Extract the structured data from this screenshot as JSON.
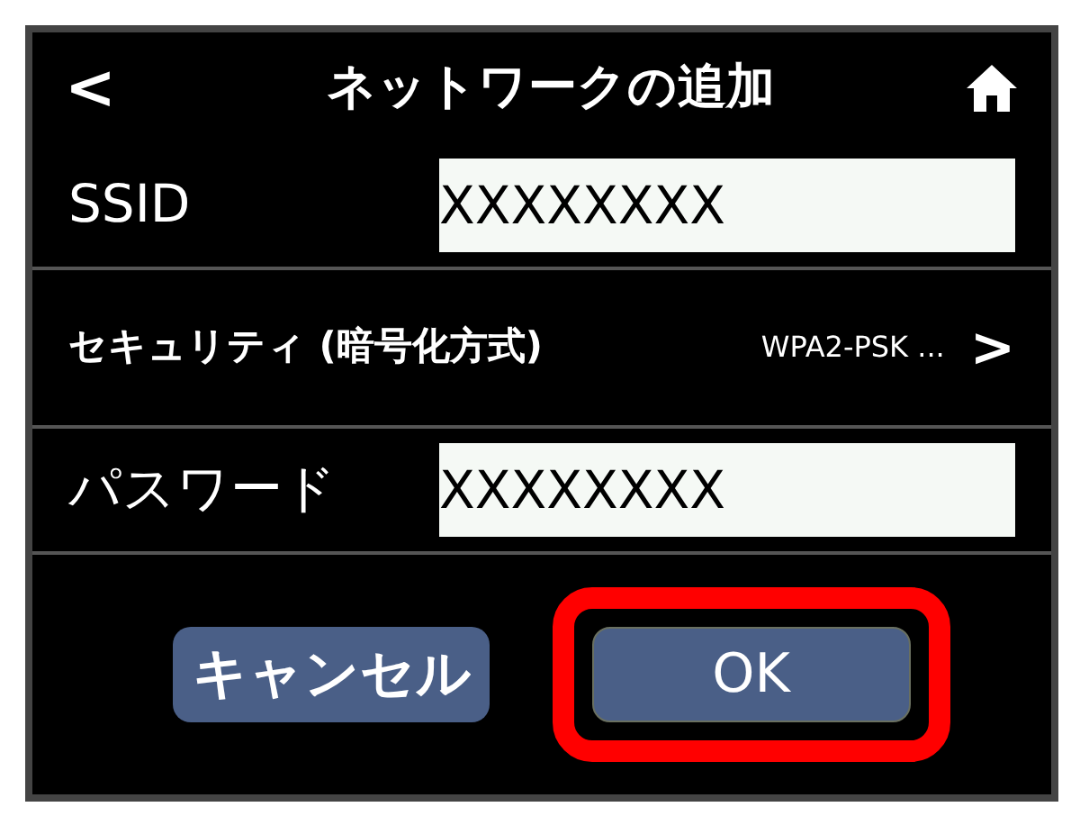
{
  "header": {
    "back": "<",
    "title": "ネットワークの追加"
  },
  "rows": [
    {
      "kind": "field",
      "label": "SSID",
      "value": "XXXXXXXX"
    },
    {
      "kind": "link",
      "label": "セキュリティ (暗号化方式)",
      "value": "WPA2-PSK ...",
      "arrow": ">"
    },
    {
      "kind": "field",
      "label": "パスワード",
      "value": "XXXXXXXX"
    }
  ],
  "buttons": [
    {
      "label": "キャンセル",
      "highlighted": false
    },
    {
      "label": "OK",
      "highlighted": true
    }
  ]
}
